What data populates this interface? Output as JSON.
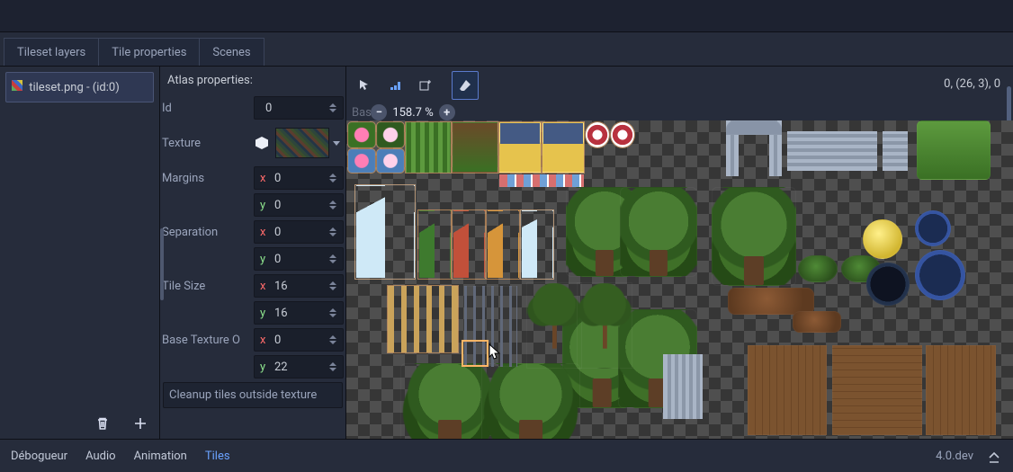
{
  "tabs": [
    "Tileset layers",
    "Tile properties",
    "Scenes"
  ],
  "atlas_list": {
    "item_label": "tileset.png - (id:0)"
  },
  "props": {
    "title": "Atlas properties:",
    "id": {
      "label": "Id",
      "value": "0"
    },
    "texture": {
      "label": "Texture"
    },
    "margins": {
      "label": "Margins",
      "x": "0",
      "y": "0"
    },
    "separation": {
      "label": "Separation",
      "x": "0",
      "y": "0"
    },
    "tile_size": {
      "label": "Tile Size",
      "x": "16",
      "y": "16"
    },
    "base_offset": {
      "label": "Base Texture O",
      "x": "0",
      "y": "22"
    },
    "cleanup": "Cleanup tiles outside texture"
  },
  "viewport": {
    "zoom_behind": "Base 1",
    "zoom": "158.7 %",
    "coord": "0, (26, 3), 0"
  },
  "footer": {
    "tabs": [
      "Débogueur",
      "Audio",
      "Animation",
      "Tiles"
    ],
    "version": "4.0.dev"
  }
}
